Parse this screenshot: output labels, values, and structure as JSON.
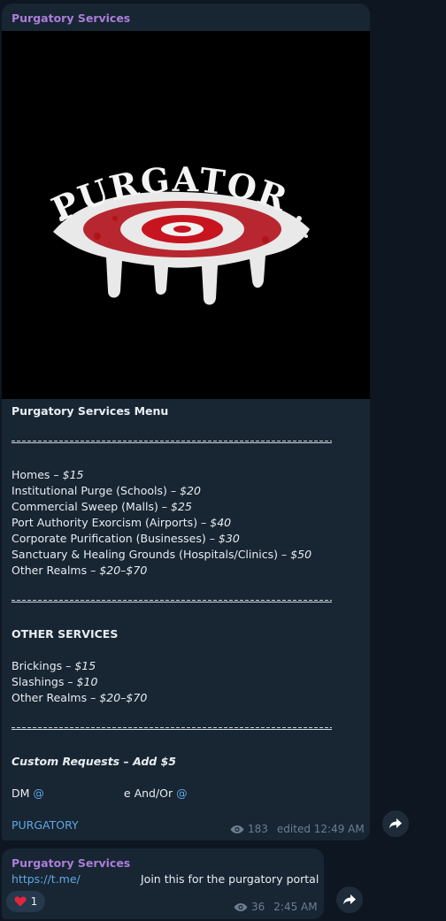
{
  "message1": {
    "sender": "Purgatory Services",
    "image_label": "PURGATORY",
    "title": "Purgatory Services Menu",
    "separator": "~~~~~~~~~~~~~~~~~~~~~~~~~~~~~~~~~~~~~~~~~~~~",
    "menu": [
      {
        "label": "Homes – ",
        "price": "$15"
      },
      {
        "label": "Institutional Purge (Schools) – ",
        "price": "$20"
      },
      {
        "label": "Commercial Sweep (Malls) – ",
        "price": "$25"
      },
      {
        "label": "Port Authority Exorcism (Airports) – ",
        "price": "$40"
      },
      {
        "label": "Corporate Purification (Businesses) – ",
        "price": "$30"
      },
      {
        "label": "Sanctuary & Healing Grounds (Hospitals/Clinics) – ",
        "price": "$50"
      },
      {
        "label": "Other Realms – ",
        "price": "$20–$70"
      }
    ],
    "other_heading": "OTHER SERVICES",
    "other": [
      {
        "label": "Brickings – ",
        "price": "$15"
      },
      {
        "label": "Slashings – ",
        "price": "$10"
      },
      {
        "label": "Other Realms – ",
        "price": "$20–$70"
      }
    ],
    "custom": "Custom Requests – Add $5",
    "dm_prefix": "DM ",
    "dm_at1": "@",
    "dm_trail": "e",
    "dm_mid": " And/Or ",
    "dm_at2": "@",
    "signature": "PURGATORY",
    "views": "183",
    "time": "edited 12:49 AM"
  },
  "message2": {
    "sender": "Purgatory Services",
    "link": "https://t.me/",
    "text": "Join this for the purgatory portal",
    "reaction_count": "1",
    "views": "36",
    "time": "2:45 AM"
  },
  "icons": [
    "eye-icon",
    "forward-icon",
    "heart-icon"
  ],
  "colors": {
    "background": "#0e1621",
    "bubble": "#182533",
    "sender": "#a97ed8",
    "link": "#5fa8e4",
    "meta": "#6d7f8f"
  }
}
